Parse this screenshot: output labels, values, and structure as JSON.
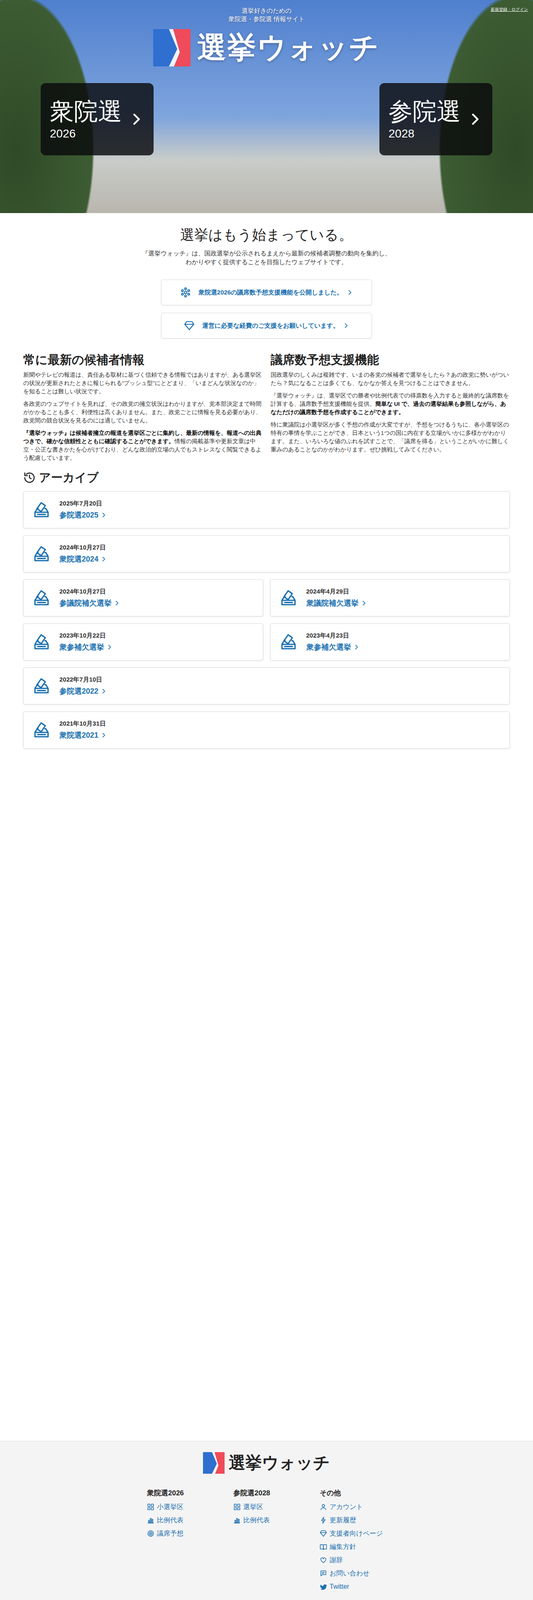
{
  "hero": {
    "top_link": "新規登録・ログイン",
    "tagline": [
      "選挙好きのための",
      "衆院選・参院選 情報サイト"
    ],
    "site_name": "選挙ウォッチ",
    "elections": [
      {
        "label": "衆院選",
        "year": "2026"
      },
      {
        "label": "参院選",
        "year": "2028"
      }
    ]
  },
  "intro": {
    "title": "選挙はもう始まっている。",
    "lines": [
      "『選挙ウォッチ』は、国政選挙が公示されるまえから最新の候補者調整の動向を集約し、",
      "わかりやすく提供することを目指したウェブサイトです。"
    ]
  },
  "notices": [
    {
      "text": "衆院選2026の議席数予想支援機能を公開しました。"
    },
    {
      "text": "運営に必要な経費のご支援をお願いしています。"
    }
  ],
  "features": [
    {
      "title": "常に最新の候補者情報",
      "paragraphs": [
        [
          {
            "text": "新聞やテレビの報道は、責任ある取材に基づく信頼できる情報ではありますが、ある選挙区の状況が更新されたときに報じられる“プッシュ型”にとどまり、「いまどんな状況なのか」を知ることは難しい状況です。",
            "bold": false
          }
        ],
        [
          {
            "text": "各政党のウェブサイトを見れば、その政党の擁立状況はわかりますが、党本部決定まで時間がかかることも多く、利便性は高くありません。また、政党ごとに情報を見る必要があり、政党間の競合状況を見るのには適していません。",
            "bold": false
          }
        ],
        [
          {
            "text": "『選挙ウォッチ』は候補者擁立の報道を選挙区ごとに集約し、最新の情報を、報道への出典つきで、確かな信頼性とともに確認することができます。",
            "bold": true
          },
          {
            "text": "情報の掲載基準や更新文章は中立・公正な書きかたを心がけており、どんな政治的立場の人でもストレスなく閲覧できるよう配慮しています。",
            "bold": false
          }
        ]
      ]
    },
    {
      "title": "議席数予想支援機能",
      "paragraphs": [
        [
          {
            "text": "国政選挙のしくみは複雑です。いまの各党の候補者で選挙をしたら？あの政党に勢いがついたら？気になることは多くても、なかなか答えを見つけることはできません。",
            "bold": false
          }
        ],
        [
          {
            "text": "『選挙ウォッチ』は、選挙区での勝者や比例代表での得票数を入力すると最終的な議席数を計算する、議席数予想支援機能を提供。",
            "bold": false
          },
          {
            "text": "簡単な UI で、過去の選挙結果も参照しながら、あなただけの議席数予想を作成することができます。",
            "bold": true
          }
        ],
        [
          {
            "text": "特に衆議院は小選挙区が多く予想の作成が大変ですが、予想をつけるうちに、各小選挙区の特有の事情を学ぶことができ、日本という1つの国に内在する立場がいかに多様かがわかります。また、いろいろな値のぶれを試すことで、「議席を得る」ということがいかに難しく重みのあることなのかがわかります。ぜひ挑戦してみてください。",
            "bold": false
          }
        ]
      ]
    }
  ],
  "archive": {
    "title": "アーカイブ",
    "items": [
      {
        "date": "2025年7月20日",
        "name": "参院選2025",
        "kind": "full"
      },
      {
        "date": "2024年10月27日",
        "name": "衆院選2024",
        "kind": "full"
      },
      {
        "date": "2024年10月27日",
        "name": "参議院補欠選挙",
        "kind": "half"
      },
      {
        "date": "2024年4月29日",
        "name": "衆議院補欠選挙",
        "kind": "half"
      },
      {
        "date": "2023年10月22日",
        "name": "衆参補欠選挙",
        "kind": "half"
      },
      {
        "date": "2023年4月23日",
        "name": "衆参補欠選挙",
        "kind": "half"
      },
      {
        "date": "2022年7月10日",
        "name": "参院選2022",
        "kind": "full"
      },
      {
        "date": "2021年10月31日",
        "name": "衆院選2021",
        "kind": "full"
      }
    ]
  },
  "footer": {
    "site_name": "選挙ウォッチ",
    "columns": [
      {
        "title": "衆院選2026",
        "links": [
          "小選挙区",
          "比例代表",
          "議席予想"
        ]
      },
      {
        "title": "参院選2028",
        "links": [
          "選挙区",
          "比例代表"
        ]
      },
      {
        "title": "その他",
        "links": [
          "アカウント",
          "更新履歴",
          "支援者向けページ",
          "編集方針",
          "謝辞",
          "お問い合わせ",
          "Twitter"
        ]
      }
    ]
  }
}
